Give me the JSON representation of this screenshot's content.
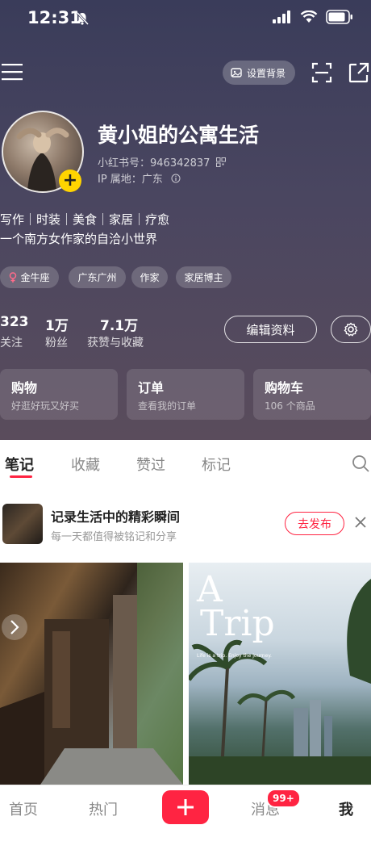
{
  "status": {
    "time": "12:31"
  },
  "profile": {
    "set_bg_label": "设置背景",
    "username": "黄小姐的公寓生活",
    "id_label": "小红书号：946342837",
    "ip_label": "IP 属地：广东",
    "bio_line1": "写作｜时装｜美食｜家居｜疗愈",
    "bio_line2": "一个南方女作家的自洽小世界",
    "tags": [
      "金牛座",
      "广东广州",
      "作家",
      "家居博主"
    ],
    "stats": [
      {
        "num": "323",
        "label": "关注"
      },
      {
        "num": "1万",
        "label": "粉丝"
      },
      {
        "num": "7.1万",
        "label": "获赞与收藏"
      }
    ],
    "edit_label": "编辑资料"
  },
  "cards": [
    {
      "title": "购物",
      "sub": "好逛好玩又好买"
    },
    {
      "title": "订单",
      "sub": "查看我的订单"
    },
    {
      "title": "购物车",
      "sub": "106 个商品"
    }
  ],
  "tabs": [
    "笔记",
    "收藏",
    "赞过",
    "标记"
  ],
  "banner": {
    "title": "记录生活中的精彩瞬间",
    "sub": "每一天都值得被铭记和分享",
    "button": "去发布"
  },
  "photos": {
    "trip_a": "A",
    "trip_t": "Trip",
    "trip_sub": "Life is a trip. Enjoy the journey."
  },
  "bottom_nav": {
    "home": "首页",
    "hot": "热门",
    "messages": "消息",
    "me": "我",
    "badge": "99+"
  },
  "colors": {
    "accent": "#ff2442",
    "plus_yellow": "#ffd400"
  }
}
